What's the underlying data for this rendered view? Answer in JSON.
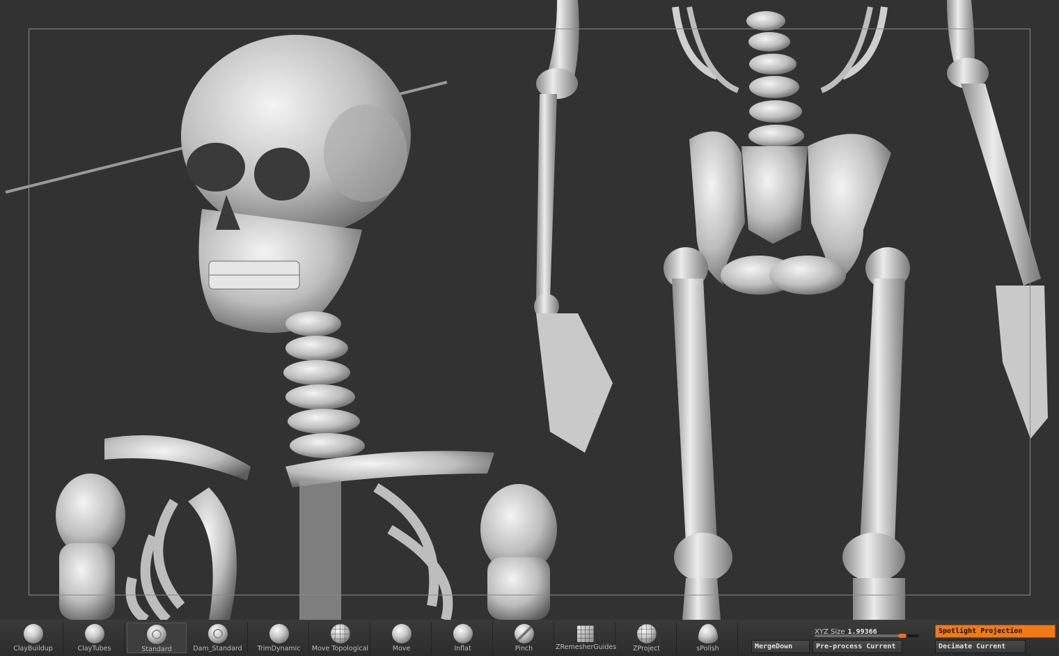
{
  "brushes": [
    {
      "label": "ClayBuildup",
      "icon": "sphere-brush-icon"
    },
    {
      "label": "ClayTubes",
      "icon": "sphere-brush-icon"
    },
    {
      "label": "Standard",
      "icon": "swirl-brush-icon",
      "active": true
    },
    {
      "label": "Dam_Standard",
      "icon": "swirl-brush-icon"
    },
    {
      "label": "TrimDynamic",
      "icon": "sphere-brush-icon"
    },
    {
      "label": "Move Topological",
      "icon": "grid-brush-icon"
    },
    {
      "label": "Move",
      "icon": "sphere-brush-icon"
    },
    {
      "label": "Inflat",
      "icon": "sphere-brush-icon"
    },
    {
      "label": "Pinch",
      "icon": "dam-brush-icon"
    },
    {
      "label": "ZRemesherGuides",
      "icon": "cube-grid-icon"
    },
    {
      "label": "ZProject",
      "icon": "grid-brush-icon"
    },
    {
      "label": "sPolish",
      "icon": "cone-brush-icon"
    }
  ],
  "xyz_size": {
    "label": "XYZ Size",
    "value": "1.99366",
    "fraction": 0.84
  },
  "buttons": {
    "merge_down": "MergeDown",
    "preprocess": "Pre-process Current",
    "spotlight": "Spotlight Projection",
    "decimate": "Decimate Current"
  },
  "colors": {
    "accent": "#f07a16",
    "viewport_bg": "#323232",
    "bone": "#d8d8d8"
  }
}
